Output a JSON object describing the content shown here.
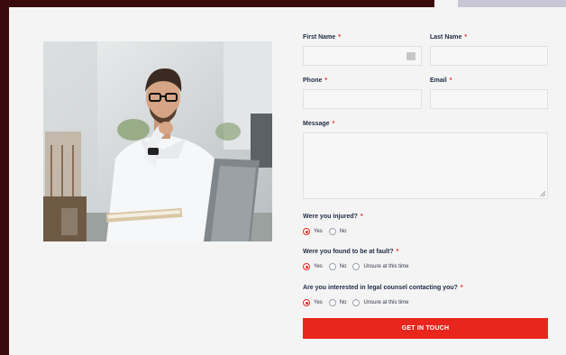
{
  "form": {
    "first_name_label": "First Name",
    "last_name_label": "Last Name",
    "phone_label": "Phone",
    "email_label": "Email",
    "message_label": "Message",
    "required_marker": "*",
    "first_name_value": "",
    "last_name_value": "",
    "phone_value": "",
    "email_value": "",
    "message_value": ""
  },
  "questions": [
    {
      "text": "Were you injured?",
      "options": [
        "Yes",
        "No"
      ],
      "selected": "Yes"
    },
    {
      "text": "Were you found to be at fault?",
      "options": [
        "Yes",
        "No",
        "Unsure at this time"
      ],
      "selected": "Yes"
    },
    {
      "text": "Are you interested in legal counsel contacting you?",
      "options": [
        "Yes",
        "No",
        "Unsure at this time"
      ],
      "selected": "Yes"
    }
  ],
  "submit_label": "GET IN TOUCH",
  "colors": {
    "accent": "#e8261d",
    "text": "#1f2a44",
    "card_bg": "#f4f4f4",
    "page_bg": "#3a0a0c"
  },
  "photo": {
    "icon": "man-at-laptop-photo"
  }
}
